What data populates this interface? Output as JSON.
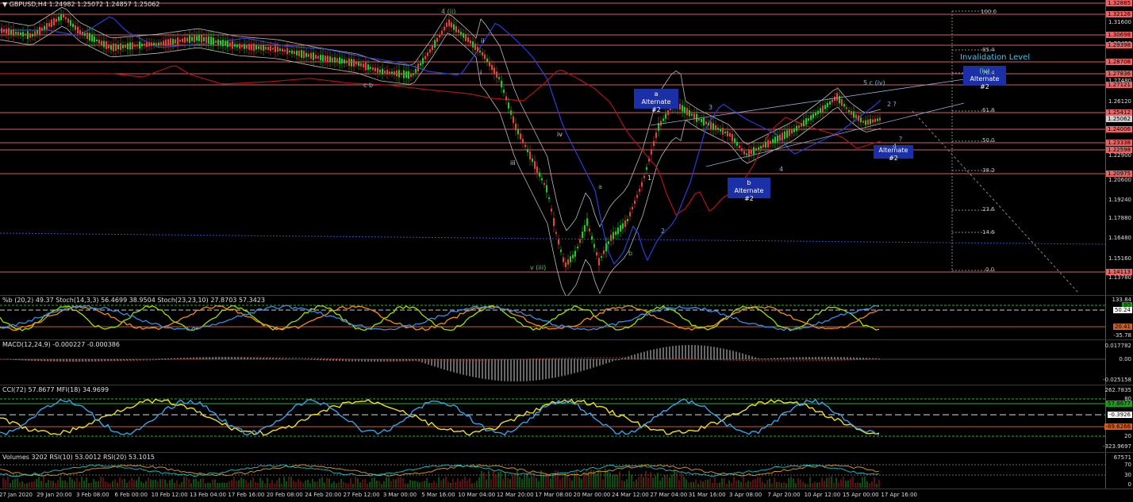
{
  "main": {
    "label": "GBPUSD,H4  1.24982 1.25072 1.24857 1.25062",
    "price_ticks": [
      "1.31600",
      "1.29420",
      "1.27480",
      "1.26120",
      "1.24220",
      "1.22900",
      "1.20600",
      "1.19240",
      "1.17880",
      "1.16480",
      "1.15160",
      "1.13780"
    ],
    "red_tags": [
      "1.32885",
      "1.32126",
      "1.30698",
      "1.29398",
      "1.28708",
      "1.27836",
      "1.27121",
      "1.25412",
      "1.24006",
      "1.23338",
      "1.22598",
      "1.20975",
      "1.14113"
    ],
    "current_price": "1.25062",
    "fib_labels": [
      "100.0",
      "85.4",
      "76.4",
      "61.8",
      "50.0",
      "38.2",
      "23.6",
      "14.6",
      "0.0"
    ],
    "invalidation_title": "Invalidation Level",
    "alt_boxes": [
      {
        "top": "a",
        "bottom": "Alternate #2"
      },
      {
        "top": "b",
        "bottom": "Alternate #2"
      },
      {
        "top": "(iv)",
        "bottom": "Alternate #2"
      },
      {
        "top": "",
        "bottom": "Alternate #2"
      }
    ],
    "wave_labels": [
      "4 (ii)",
      "ii",
      "i",
      "c b",
      "iii",
      "iv",
      "a",
      "b",
      "v (iii)",
      "2",
      "3",
      "4",
      "5 c (iv)",
      "2 ?",
      "4",
      "?",
      "1"
    ]
  },
  "stoch": {
    "label": "%b (20,2) 49.37  Stoch(14,3,3) 56.4699 38.9504  Stoch(23,23,10) 27.8703 57.3423",
    "ticks": [
      "133.84",
      "80",
      "50.24",
      "20",
      "-35.78"
    ],
    "tag_top": "80",
    "tag_mid": "50.24",
    "tag_low": "20.41"
  },
  "macd": {
    "label": "MACD(12,24,9) -0.000227 -0.000386",
    "ticks": [
      "0.017782",
      "0.00",
      "-0.025158"
    ]
  },
  "cci": {
    "label": "CCI(72) 57.8677  MFI(18) 34.9699",
    "ticks": [
      "262.7835",
      "80",
      "20",
      "-323.9697"
    ],
    "tag_green": "57.8677",
    "tag_white": "-0.3926",
    "tag_orange": "-89.6266"
  },
  "volume": {
    "label": "Volumes 3202  RSI(10) 53.0012  RSI(20) 53.1015",
    "ticks": [
      "67571",
      "70",
      "30",
      "0"
    ]
  },
  "time_labels": [
    "27 Jan 2020",
    "29 Jan 20:00",
    "3 Feb 08:00",
    "6 Feb 00:00",
    "10 Feb 12:00",
    "13 Feb 04:00",
    "17 Feb 16:00",
    "20 Feb 08:00",
    "24 Feb 20:00",
    "27 Feb 12:00",
    "3 Mar 00:00",
    "5 Mar 16:00",
    "10 Mar 04:00",
    "12 Mar 20:00",
    "17 Mar 08:00",
    "20 Mar 00:00",
    "24 Mar 12:00",
    "27 Mar 04:00",
    "31 Mar 16:00",
    "3 Apr 08:00",
    "7 Apr 20:00",
    "10 Apr 12:00",
    "15 Apr 00:00",
    "17 Apr 16:00"
  ],
  "colors": {
    "bull": "#1fcc1f",
    "bear": "#e0443a",
    "ma_red": "#b01515",
    "ma_blue": "#2840d8",
    "band": "#bbbbbb"
  }
}
